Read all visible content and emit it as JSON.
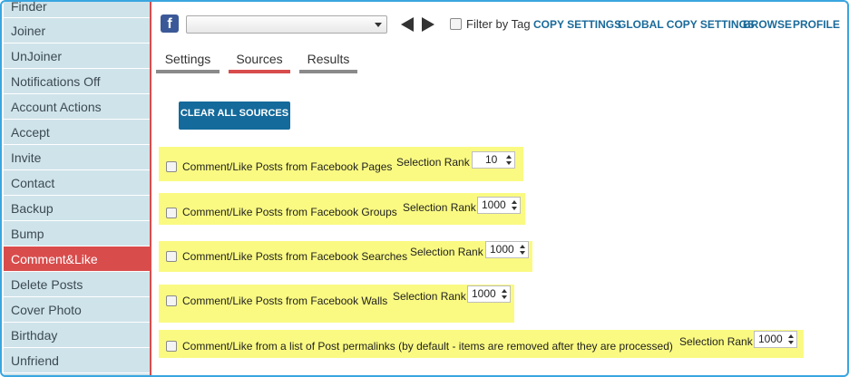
{
  "sidebar": {
    "items": [
      {
        "label": "Finder"
      },
      {
        "label": "Joiner"
      },
      {
        "label": "UnJoiner"
      },
      {
        "label": "Notifications Off"
      },
      {
        "label": "Account Actions"
      },
      {
        "label": "Accept"
      },
      {
        "label": "Invite"
      },
      {
        "label": "Contact"
      },
      {
        "label": "Backup"
      },
      {
        "label": "Bump"
      },
      {
        "label": "Comment&Like"
      },
      {
        "label": "Delete Posts"
      },
      {
        "label": "Cover Photo"
      },
      {
        "label": "Birthday"
      },
      {
        "label": "Unfriend"
      }
    ],
    "active": "Comment&Like"
  },
  "topbar": {
    "facebook_icon_glyph": "f",
    "account_select": {
      "value": ""
    },
    "filter_label": "Filter by Tag",
    "filter_checked": false,
    "links": {
      "copy_settings": "COPY SETTINGS",
      "global_copy_settings": "GLOBAL COPY SETTINGS",
      "browse": "BROWSE",
      "profile": "PROFILE"
    }
  },
  "tabs": {
    "settings": "Settings",
    "sources": "Sources",
    "results": "Results",
    "active": "Sources"
  },
  "clear_button": "CLEAR ALL SOURCES",
  "sources": {
    "rank_label": "Selection Rank",
    "rows": [
      {
        "label": "Comment/Like Posts from Facebook Pages",
        "rank": "10",
        "checked": false
      },
      {
        "label": "Comment/Like Posts from Facebook Groups",
        "rank": "1000",
        "checked": false
      },
      {
        "label": "Comment/Like Posts from Facebook Searches",
        "rank": "1000",
        "checked": false
      },
      {
        "label": "Comment/Like Posts from Facebook Walls",
        "rank": "1000",
        "checked": false
      },
      {
        "label": "Comment/Like from a list of Post permalinks (by default - items are removed after they are processed)",
        "rank": "1000",
        "checked": false
      }
    ]
  },
  "colors": {
    "sidebar_bg": "#cfe3ea",
    "active_red": "#d94c4c",
    "link_blue": "#1a6a9a",
    "button_blue": "#136a9b",
    "highlight_yellow": "#fafa82",
    "frame_blue": "#3aa6e0"
  }
}
